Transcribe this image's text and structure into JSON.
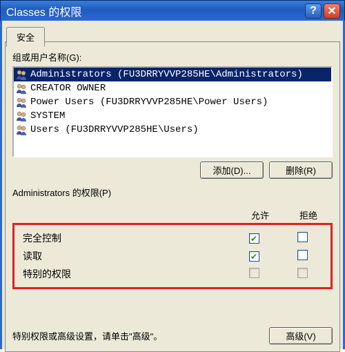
{
  "title": "Classes 的权限",
  "tab": {
    "security": "安全"
  },
  "labels": {
    "groups_or_users": "组或用户名称(G):",
    "permissions_for_prefix": "Administrators 的权限(P)",
    "allow": "允许",
    "deny": "拒绝",
    "footer": "特别权限或高级设置，请单击\"高级\"。"
  },
  "buttons": {
    "add": "添加(D)...",
    "remove": "删除(R)",
    "advanced": "高级(V)"
  },
  "users": [
    {
      "name": "Administrators (FU3DRRYVVP285HE\\Administrators)",
      "selected": true
    },
    {
      "name": "CREATOR OWNER",
      "selected": false
    },
    {
      "name": "Power Users (FU3DRRYVVP285HE\\Power Users)",
      "selected": false
    },
    {
      "name": "SYSTEM",
      "selected": false
    },
    {
      "name": "Users (FU3DRRYVVP285HE\\Users)",
      "selected": false
    }
  ],
  "permissions": [
    {
      "name": "完全控制",
      "allow": true,
      "deny": false,
      "disabled": false
    },
    {
      "name": "读取",
      "allow": true,
      "deny": false,
      "disabled": false
    },
    {
      "name": "特别的权限",
      "allow": false,
      "deny": false,
      "disabled": true
    }
  ]
}
